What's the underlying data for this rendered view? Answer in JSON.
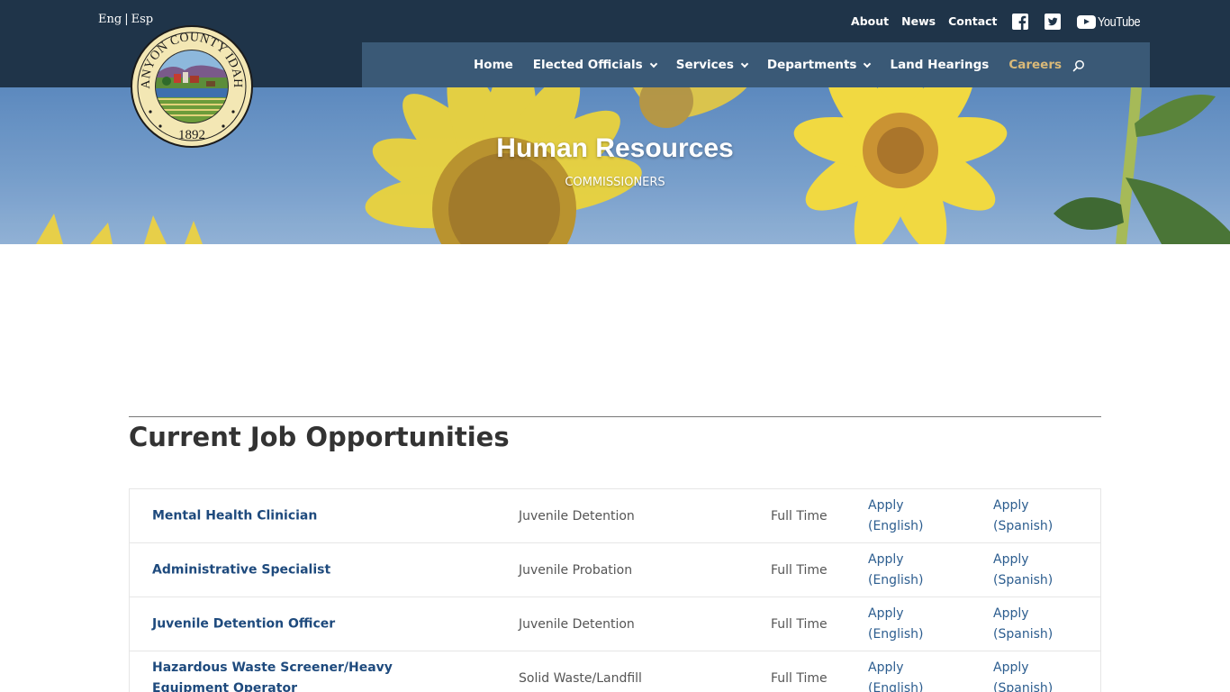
{
  "language": {
    "english": "Eng",
    "separator": "|",
    "spanish": "Esp"
  },
  "top_links": {
    "about": "About",
    "news": "News",
    "contact": "Contact",
    "youtube": "YouTube"
  },
  "seal": {
    "text": "CANYON COUNTY IDAHO",
    "year": "1892"
  },
  "nav": [
    {
      "label": "Home",
      "dropdown": false
    },
    {
      "label": "Elected Officials",
      "dropdown": true
    },
    {
      "label": "Services",
      "dropdown": true
    },
    {
      "label": "Departments",
      "dropdown": true
    },
    {
      "label": "Land Hearings",
      "dropdown": false
    },
    {
      "label": "Careers",
      "dropdown": false,
      "active": true
    }
  ],
  "hero": {
    "title": "Human Resources",
    "subtitle": "COMMISSIONERS"
  },
  "section": {
    "heading_bold": "Current",
    "heading_rest": " Job Opportunities"
  },
  "jobs": [
    {
      "title": "Mental Health Clinician",
      "department": "Juvenile Detention",
      "type": "Full Time",
      "apply_en_1": "Apply",
      "apply_en_2": "(English)",
      "apply_es_1": "Apply",
      "apply_es_2": "(Spanish)"
    },
    {
      "title": "Administrative Specialist",
      "department": "Juvenile Probation",
      "type": "Full Time",
      "apply_en_1": "Apply",
      "apply_en_2": "(English)",
      "apply_es_1": "Apply",
      "apply_es_2": "(Spanish)"
    },
    {
      "title": "Juvenile Detention Officer",
      "department": "Juvenile Detention",
      "type": "Full Time",
      "apply_en_1": "Apply",
      "apply_en_2": "(English)",
      "apply_es_1": "Apply",
      "apply_es_2": "(Spanish)"
    },
    {
      "title": "Hazardous Waste Screener/Heavy Equipment Operator",
      "department": "Solid Waste/Landfill",
      "type": "Full Time",
      "apply_en_1": "Apply",
      "apply_en_2": "(English)",
      "apply_es_1": "Apply",
      "apply_es_2": "(Spanish)"
    }
  ],
  "colors": {
    "header": "#1f3449",
    "nav": "#3a5976",
    "active_nav": "#d9b978",
    "job_link": "#1e4a7d"
  }
}
